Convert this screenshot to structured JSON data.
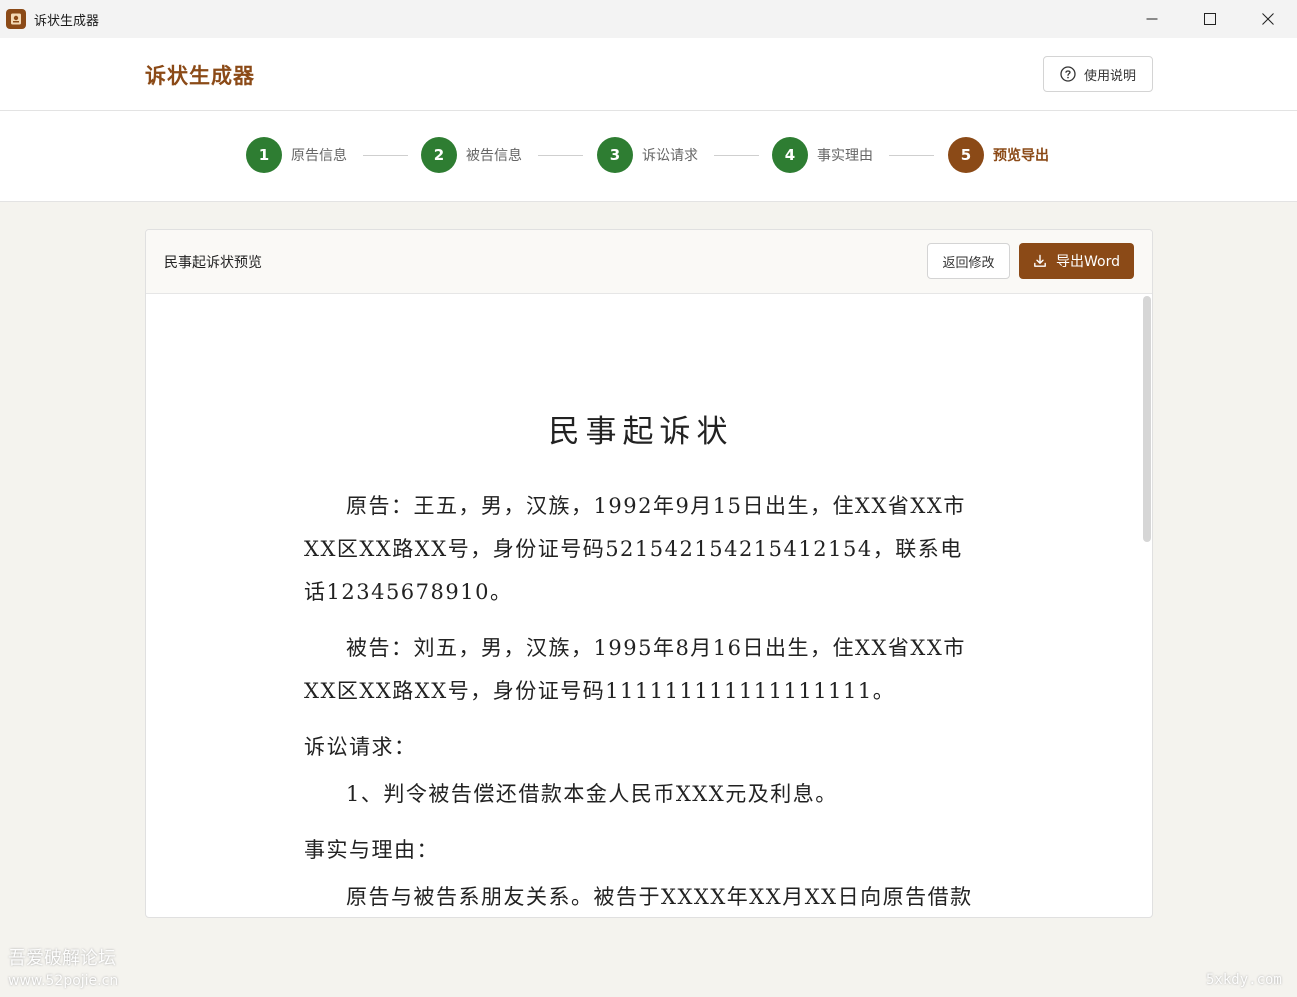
{
  "window": {
    "title": "诉状生成器",
    "icons": {
      "app": "app-logo-icon",
      "minimize": "minimize-icon",
      "maximize": "maximize-icon",
      "close": "close-icon"
    }
  },
  "header": {
    "brand": "诉状生成器",
    "help_label": "使用说明",
    "help_icon": "question-circle-icon",
    "brand_color": "#8b4a17"
  },
  "steps": [
    {
      "number": "1",
      "label": "原告信息",
      "state": "done"
    },
    {
      "number": "2",
      "label": "被告信息",
      "state": "done"
    },
    {
      "number": "3",
      "label": "诉讼请求",
      "state": "done"
    },
    {
      "number": "4",
      "label": "事实理由",
      "state": "done"
    },
    {
      "number": "5",
      "label": "预览导出",
      "state": "active"
    }
  ],
  "colors": {
    "done": "#2e7d32",
    "active": "#8b4a17"
  },
  "preview": {
    "title": "民事起诉状预览",
    "back_label": "返回修改",
    "export_label": "导出Word",
    "export_icon": "download-icon"
  },
  "document": {
    "title": "民事起诉状",
    "plaintiff": "原告：王五，男，汉族，1992年9月15日出生，住XX省XX市XX区XX路XX号，身份证号码521542154215412154，联系电话12345678910。",
    "defendant": "被告：刘五，男，汉族，1995年8月16日出生，住XX省XX市XX区XX路XX号，身份证号码111111111111111111。",
    "claims_heading": "诉讼请求：",
    "claims": [
      "1、判令被告偿还借款本金人民币XXX元及利息。"
    ],
    "facts_heading": "事实与理由：",
    "facts": "原告与被告系朋友关系。被告于XXXX年XX月XX日向原告借款"
  },
  "watermarks": {
    "left": "吾爱破解论坛",
    "left_sub": "www.52pojie.cn",
    "right": "5xkdy.com"
  }
}
